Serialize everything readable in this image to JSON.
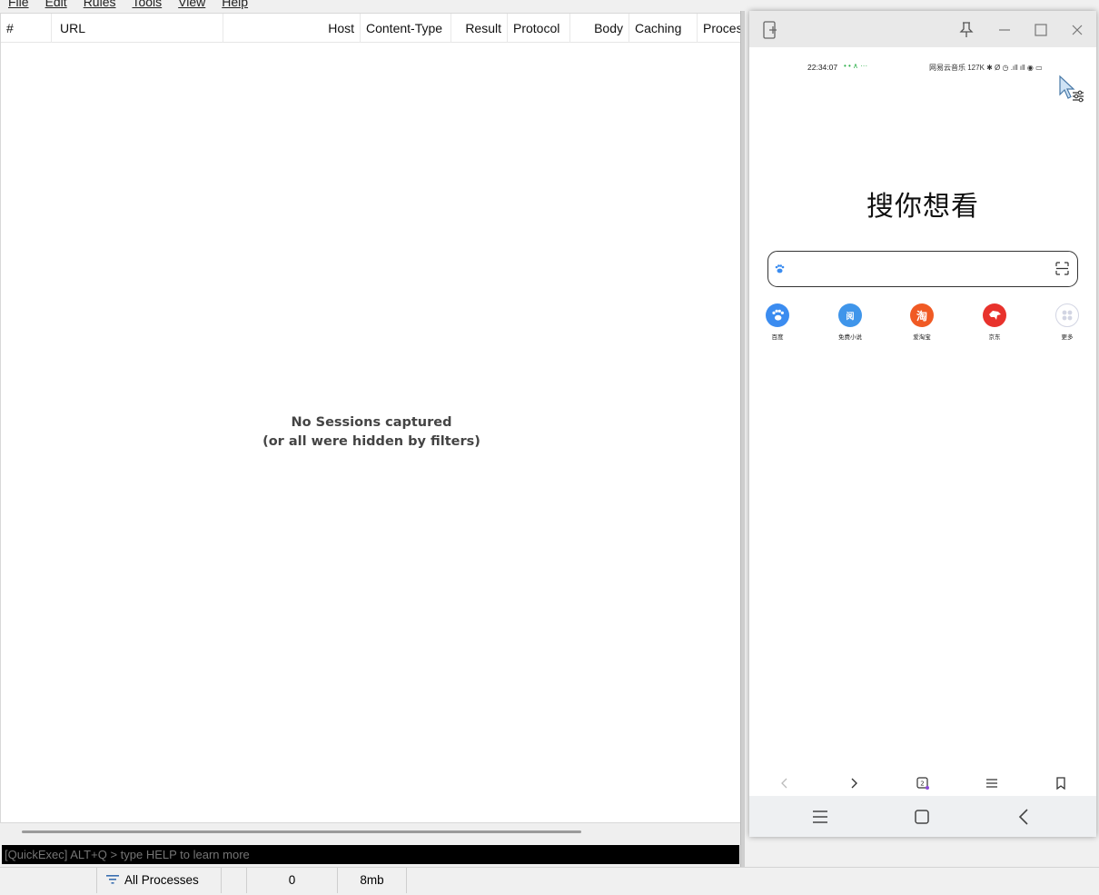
{
  "menu": [
    "File",
    "Edit",
    "Rules",
    "Tools",
    "View",
    "Help"
  ],
  "grid": {
    "columns": [
      "#",
      "URL",
      "Host",
      "Content-Type",
      "Result",
      "Protocol",
      "Body",
      "Caching",
      "Proces"
    ],
    "empty_line1": "No Sessions captured",
    "empty_line2": "(or all were hidden by filters)"
  },
  "quickexec": {
    "placeholder": "[QuickExec] ALT+Q > type HELP to learn more"
  },
  "statusbar": {
    "process_filter": "All Processes",
    "session_count": "0",
    "memory": "8mb"
  },
  "phone": {
    "status": {
      "time": "22:34:07",
      "left_icons": "• • ∧  ···",
      "right": "网易云音乐   127K ✱ Ø ◷ .ıll ıll ◉ ▭"
    },
    "title": "搜你想看",
    "search": {
      "placeholder": ""
    },
    "shortcuts": [
      {
        "label": "百度",
        "glyph": "",
        "color": "#3b8cf0"
      },
      {
        "label": "免费小说",
        "glyph": "阅",
        "color": "#3f95ea"
      },
      {
        "label": "爱淘宝",
        "glyph": "淘",
        "color": "#f05a24"
      },
      {
        "label": "京东",
        "glyph": "",
        "color": "#e8322c"
      },
      {
        "label": "更多",
        "glyph": "",
        "color": "#d9dce8"
      }
    ],
    "tab_count": "2"
  }
}
